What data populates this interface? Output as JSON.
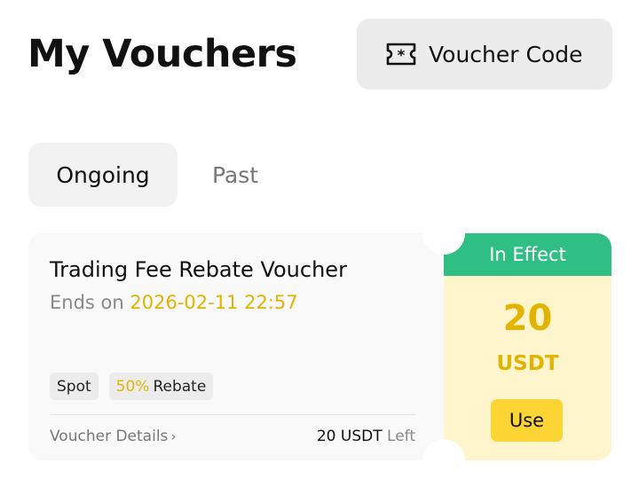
{
  "header": {
    "title": "My Vouchers",
    "voucher_code_label": "Voucher Code",
    "voucher_code_icon": "ticket-icon"
  },
  "tabs": [
    {
      "label": "Ongoing",
      "active": true
    },
    {
      "label": "Past",
      "active": false
    }
  ],
  "voucher": {
    "title": "Trading Fee Rebate Voucher",
    "ends_prefix": "Ends on",
    "ends_date": "2026-02-11 22:57",
    "tags": [
      {
        "label": "Spot"
      },
      {
        "percent": "50%",
        "label": "Rebate"
      }
    ],
    "details_link": "Voucher Details",
    "remaining_amount": "20 USDT",
    "remaining_suffix": "Left",
    "status": "In Effect",
    "amount": "20",
    "unit": "USDT",
    "use_label": "Use"
  },
  "colors": {
    "accent_yellow": "#fcd535",
    "status_green": "#2fbf85",
    "highlight_text": "#e2b300",
    "voucher_bg": "#fff5cc"
  }
}
